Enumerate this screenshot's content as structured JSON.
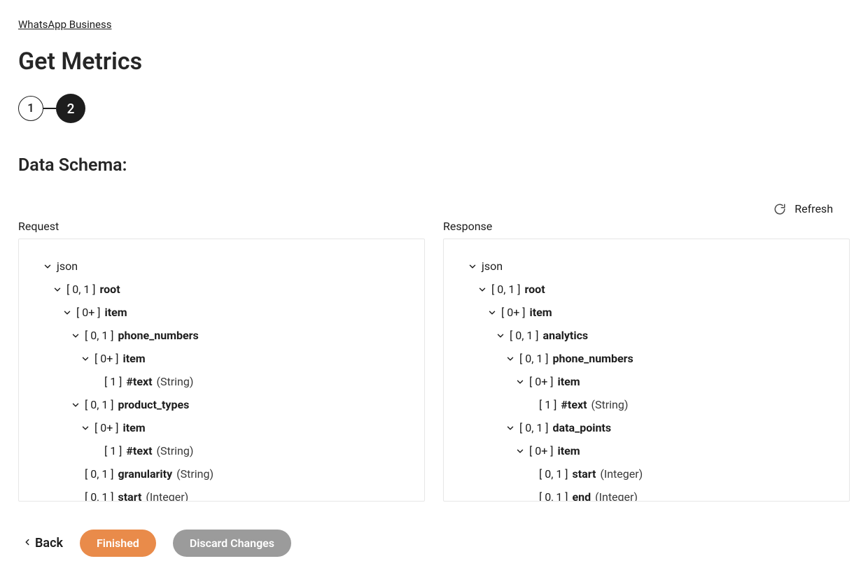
{
  "breadcrumb": {
    "label": "WhatsApp Business"
  },
  "page": {
    "title": "Get Metrics"
  },
  "stepper": {
    "steps": [
      "1",
      "2"
    ],
    "active_index": 1
  },
  "section": {
    "title": "Data Schema:"
  },
  "actions": {
    "refresh": "Refresh",
    "back": "Back",
    "finished": "Finished",
    "discard": "Discard Changes"
  },
  "panels": {
    "request": {
      "header": "Request",
      "nodes": [
        {
          "indent": 0,
          "chevron": true,
          "text": "json"
        },
        {
          "indent": 1,
          "chevron": true,
          "card": "[ 0, 1 ]",
          "name": "root"
        },
        {
          "indent": 2,
          "chevron": true,
          "card": "[ 0+ ]",
          "name": "item"
        },
        {
          "indent": 3,
          "chevron": true,
          "card": "[ 0, 1 ]",
          "name": "phone_numbers"
        },
        {
          "indent": 4,
          "chevron": true,
          "card": "[ 0+ ]",
          "name": "item"
        },
        {
          "indent": 5,
          "chevron": false,
          "card": "[ 1 ]",
          "name": "#text",
          "type": "(String)"
        },
        {
          "indent": 3,
          "chevron": true,
          "card": "[ 0, 1 ]",
          "name": "product_types"
        },
        {
          "indent": 4,
          "chevron": true,
          "card": "[ 0+ ]",
          "name": "item"
        },
        {
          "indent": 5,
          "chevron": false,
          "card": "[ 1 ]",
          "name": "#text",
          "type": "(String)"
        },
        {
          "indent": 3,
          "chevron": false,
          "card": "[ 0, 1 ]",
          "name": "granularity",
          "type": "(String)"
        },
        {
          "indent": 3,
          "chevron": false,
          "card": "[ 0, 1 ]",
          "name": "start",
          "type": "(Integer)"
        }
      ]
    },
    "response": {
      "header": "Response",
      "nodes": [
        {
          "indent": 0,
          "chevron": true,
          "text": "json"
        },
        {
          "indent": 1,
          "chevron": true,
          "card": "[ 0, 1 ]",
          "name": "root"
        },
        {
          "indent": 2,
          "chevron": true,
          "card": "[ 0+ ]",
          "name": "item"
        },
        {
          "indent": 3,
          "chevron": true,
          "card": "[ 0, 1 ]",
          "name": "analytics"
        },
        {
          "indent": 4,
          "chevron": true,
          "card": "[ 0, 1 ]",
          "name": "phone_numbers"
        },
        {
          "indent": 5,
          "chevron": true,
          "card": "[ 0+ ]",
          "name": "item"
        },
        {
          "indent": 6,
          "chevron": false,
          "card": "[ 1 ]",
          "name": "#text",
          "type": "(String)"
        },
        {
          "indent": 4,
          "chevron": true,
          "card": "[ 0, 1 ]",
          "name": "data_points"
        },
        {
          "indent": 5,
          "chevron": true,
          "card": "[ 0+ ]",
          "name": "item"
        },
        {
          "indent": 6,
          "chevron": false,
          "card": "[ 0, 1 ]",
          "name": "start",
          "type": "(Integer)"
        },
        {
          "indent": 6,
          "chevron": false,
          "card": "[ 0, 1 ]",
          "name": "end",
          "type": "(Integer)"
        }
      ]
    }
  }
}
